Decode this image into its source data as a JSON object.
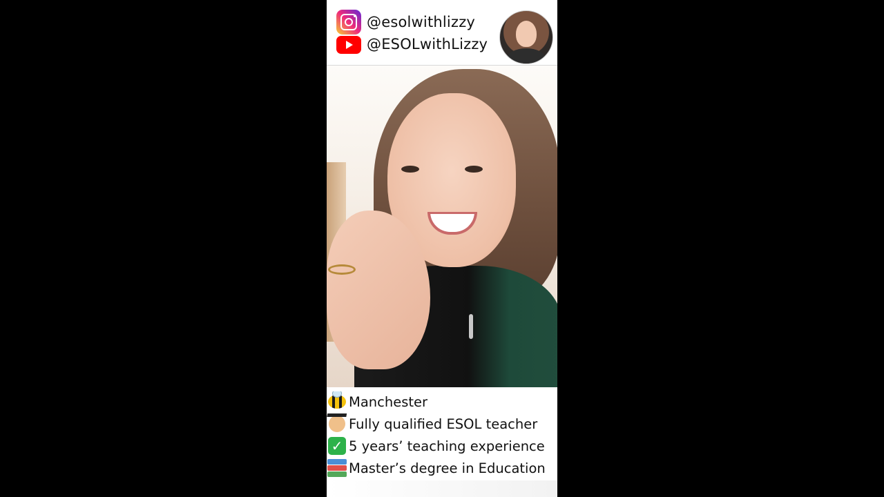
{
  "header": {
    "instagram_handle": "@esolwithlizzy",
    "youtube_handle": "@ESOLwithLizzy"
  },
  "info": {
    "items": [
      {
        "icon": "bee-icon",
        "text": "Manchester"
      },
      {
        "icon": "graduate-icon",
        "text": "Fully qualified ESOL teacher"
      },
      {
        "icon": "checkmark-icon",
        "text": "5 years’ teaching experience"
      },
      {
        "icon": "books-icon",
        "text": "Master’s degree in Education"
      }
    ]
  },
  "colors": {
    "background": "#000000",
    "youtube_red": "#ff0000",
    "check_green": "#2db24a"
  }
}
